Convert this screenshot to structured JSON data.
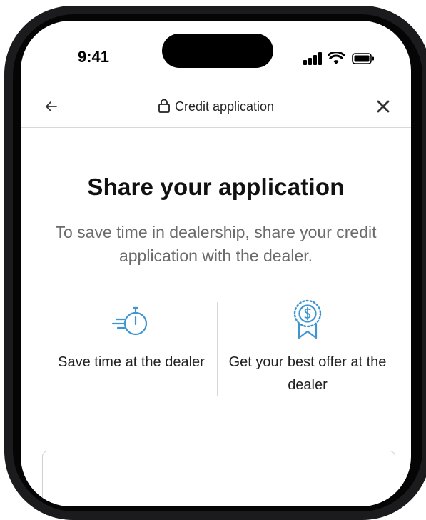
{
  "status_bar": {
    "time": "9:41",
    "icons": [
      "cellular-signal-icon",
      "wifi-icon",
      "battery-icon"
    ]
  },
  "nav": {
    "back_icon": "arrow-left-icon",
    "title_icon": "lock-icon",
    "title": "Credit application",
    "close_icon": "close-icon"
  },
  "main": {
    "headline": "Share your application",
    "subtext": "To save time in dealership, share your credit application with the dealer."
  },
  "features": [
    {
      "icon": "stopwatch-icon",
      "text": "Save time at the dealer"
    },
    {
      "icon": "award-ribbon-dollar-icon",
      "text": "Get your best offer at the dealer"
    }
  ],
  "colors": {
    "icon_accent": "#3e95d0",
    "subtext": "#6b6b6b",
    "divider": "#d8d8d8"
  }
}
